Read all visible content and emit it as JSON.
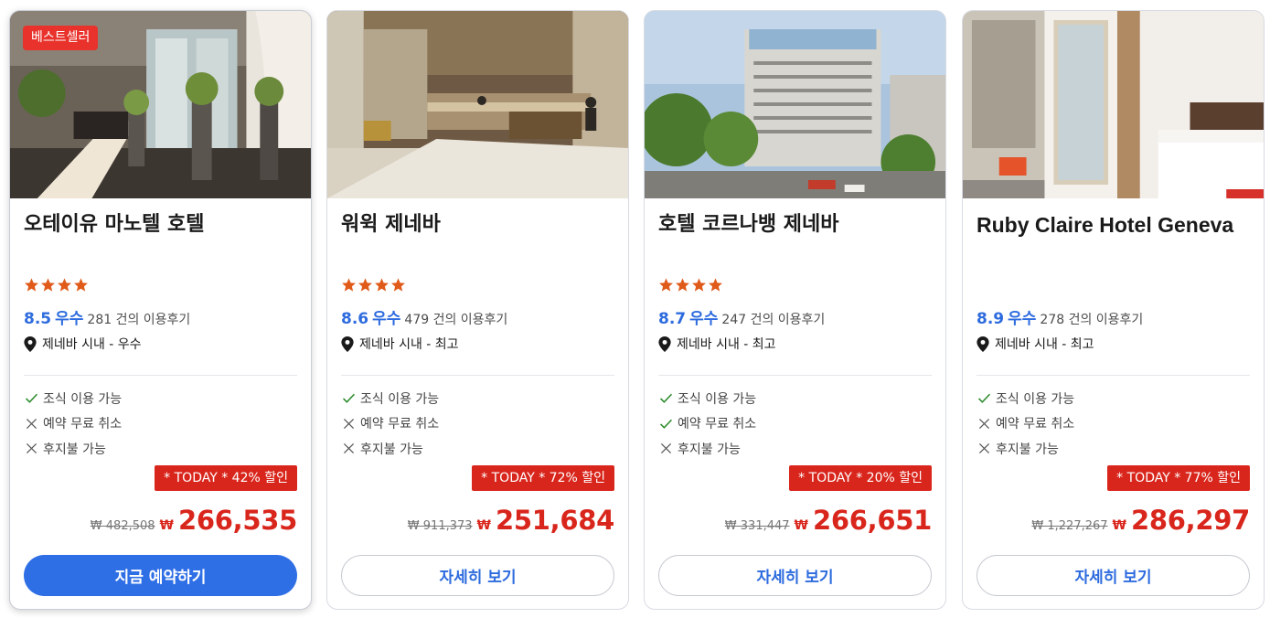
{
  "colors": {
    "accent": "#2f6fe6",
    "sale_red": "#d9261c",
    "star": "#e05a1a",
    "check": "#2a8a2a"
  },
  "hotels": [
    {
      "badge": "베스트셀러",
      "name": "오테이유 마노텔 호텔",
      "stars": 4,
      "score": "8.5",
      "score_label": "우수",
      "reviews": "281 건의 이용후기",
      "location": "제네바 시내 - 우수",
      "features": [
        {
          "label": "조식 이용 가능",
          "icon": "check-icon",
          "available": true
        },
        {
          "label": "예약 무료 취소",
          "icon": "cross-icon",
          "available": false
        },
        {
          "label": "후지불 가능",
          "icon": "cross-icon",
          "available": false
        }
      ],
      "discount": "* TODAY * 42% 할인",
      "old_price": "₩ 482,508",
      "currency": "₩",
      "price": "266,535",
      "button": "지금 예약하기"
    },
    {
      "badge": "",
      "name": "워윅 제네바",
      "stars": 4,
      "score": "8.6",
      "score_label": "우수",
      "reviews": "479 건의 이용후기",
      "location": "제네바 시내 - 최고",
      "features": [
        {
          "label": "조식 이용 가능",
          "icon": "check-icon",
          "available": true
        },
        {
          "label": "예약 무료 취소",
          "icon": "cross-icon",
          "available": false
        },
        {
          "label": "후지불 가능",
          "icon": "cross-icon",
          "available": false
        }
      ],
      "discount": "* TODAY * 72% 할인",
      "old_price": "₩ 911,373",
      "currency": "₩",
      "price": "251,684",
      "button": "자세히 보기"
    },
    {
      "badge": "",
      "name": "호텔 코르나뱅 제네바",
      "stars": 4,
      "score": "8.7",
      "score_label": "우수",
      "reviews": "247 건의 이용후기",
      "location": "제네바 시내 - 최고",
      "features": [
        {
          "label": "조식 이용 가능",
          "icon": "check-icon",
          "available": true
        },
        {
          "label": "예약 무료 취소",
          "icon": "check-icon",
          "available": true
        },
        {
          "label": "후지불 가능",
          "icon": "cross-icon",
          "available": false
        }
      ],
      "discount": "* TODAY * 20% 할인",
      "old_price": "₩ 331,447",
      "currency": "₩",
      "price": "266,651",
      "button": "자세히 보기"
    },
    {
      "badge": "",
      "name": "Ruby Claire Hotel Geneva",
      "stars": 0,
      "score": "8.9",
      "score_label": "우수",
      "reviews": "278 건의 이용후기",
      "location": "제네바 시내 - 최고",
      "features": [
        {
          "label": "조식 이용 가능",
          "icon": "check-icon",
          "available": true
        },
        {
          "label": "예약 무료 취소",
          "icon": "cross-icon",
          "available": false
        },
        {
          "label": "후지불 가능",
          "icon": "cross-icon",
          "available": false
        }
      ],
      "discount": "* TODAY * 77% 할인",
      "old_price": "₩ 1,227,267",
      "currency": "₩",
      "price": "286,297",
      "button": "자세히 보기"
    }
  ]
}
